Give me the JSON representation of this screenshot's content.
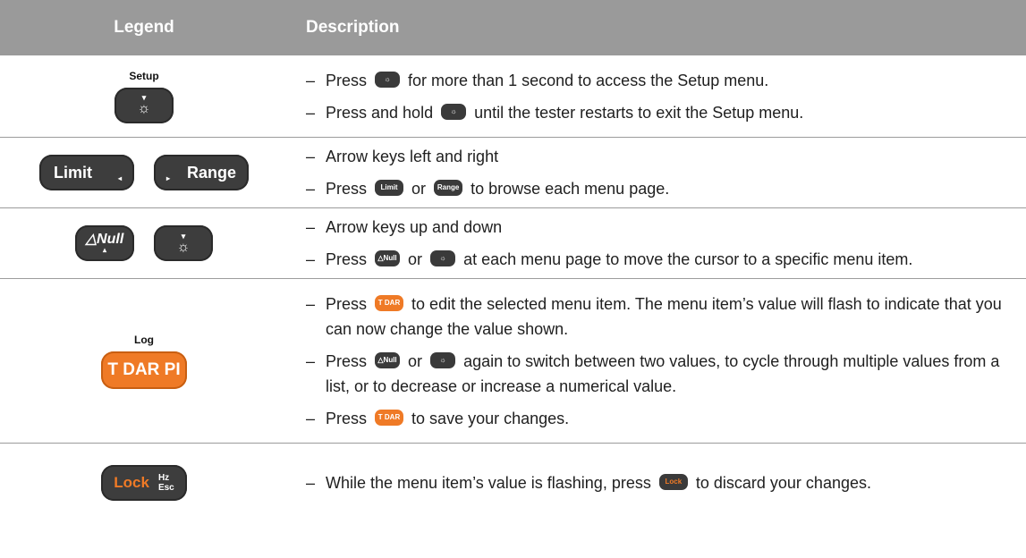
{
  "table": {
    "headers": {
      "legend": "Legend",
      "description": "Description"
    },
    "rows": [
      {
        "keys": {
          "setup_label": "Setup",
          "sun_glyph": "☼",
          "down_arrow": "▾"
        },
        "lines": [
          {
            "dash": "–",
            "before": "Press",
            "after": "for more than 1 second to access the Setup menu."
          },
          {
            "dash": "–",
            "before": "Press and hold",
            "after": "until the tester restarts to exit the Setup menu."
          }
        ]
      },
      {
        "keys": {
          "limit_label": "Limit",
          "range_label": "Range",
          "left_tri": "◂",
          "right_tri": "▸"
        },
        "lines": [
          {
            "dash": "–",
            "text": "Arrow keys left and right"
          },
          {
            "dash": "–",
            "before": "Press",
            "middle": "or",
            "after": "to browse each menu page.",
            "mini_limit": "Limit",
            "mini_range": "Range"
          }
        ]
      },
      {
        "keys": {
          "null_label": "△Null",
          "up_tri": "▴",
          "sun_glyph": "☼",
          "down_arrow": "▾"
        },
        "lines": [
          {
            "dash": "–",
            "text": "Arrow keys up and down"
          },
          {
            "dash": "–",
            "before": "Press",
            "middle": "or",
            "after": "at each menu page to move the cursor to a specific menu item.",
            "mini_null": "△Null"
          }
        ]
      },
      {
        "keys": {
          "log_label": "Log",
          "tdar_label": "T DAR PI"
        },
        "lines": [
          {
            "dash": "–",
            "before": "Press",
            "after": "to edit the selected menu item. The menu item’s value will flash to indicate that you can now change the value shown.",
            "mini_tdar": "T DAR PI"
          },
          {
            "dash": "–",
            "before": "Press",
            "middle": "or",
            "after": "again to switch between two values, to cycle through multiple values from a list, or to decrease or increase a numerical value.",
            "mini_null": "△Null"
          },
          {
            "dash": "–",
            "before": "Press",
            "after": "to save your changes.",
            "mini_tdar": "T DAR PI"
          }
        ]
      },
      {
        "keys": {
          "lock_label": "Lock",
          "hz_label": "Hz",
          "esc_label": "Esc"
        },
        "lines": [
          {
            "dash": "–",
            "before": "While the menu item’s value is flashing, press",
            "after": "to discard your changes.",
            "mini_lock": "Lock"
          }
        ]
      }
    ]
  },
  "colors": {
    "header_bg": "#9a9a9a",
    "key_dark": "#3d3d3d",
    "key_orange": "#ef7a26"
  }
}
